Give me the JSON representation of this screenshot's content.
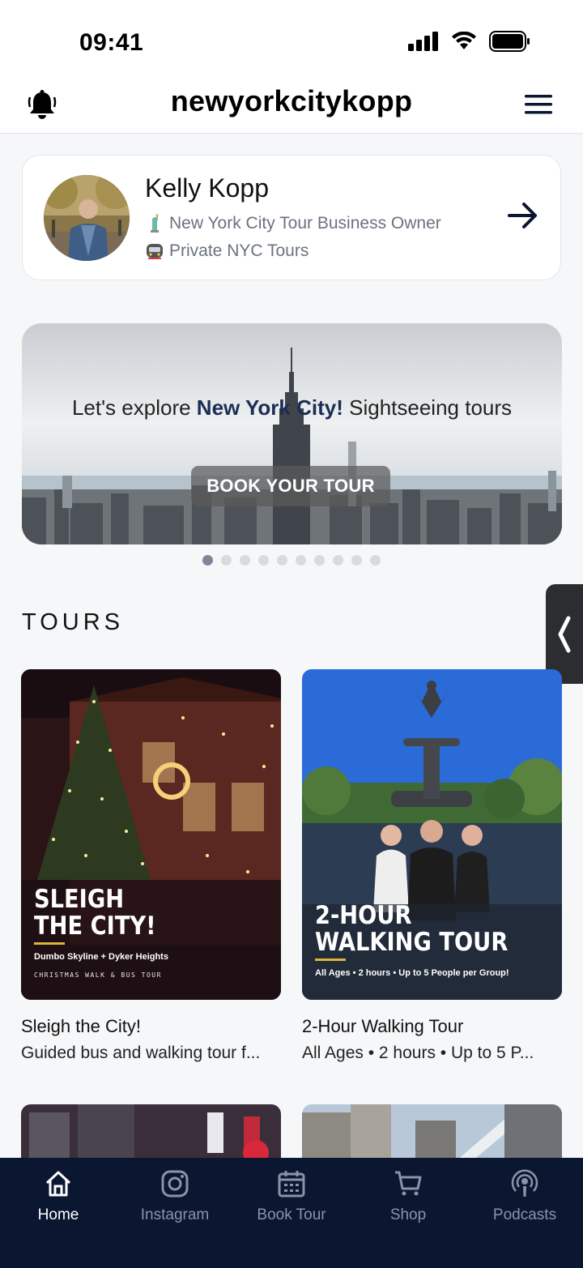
{
  "status": {
    "time": "09:41"
  },
  "header": {
    "title": "newyorkcitykopp"
  },
  "profile": {
    "name": "Kelly Kopp",
    "line1": "New York City Tour Business Owner",
    "line2": "Private NYC Tours"
  },
  "banner": {
    "text_before": "Let's explore ",
    "text_bold1": "New York",
    "text_bold2": "City!",
    "text_after": " Sightseeing tours",
    "button_label": "BOOK YOUR TOUR",
    "slide_count": 10,
    "active_slide": 1
  },
  "tours_section": {
    "title": "TOURS"
  },
  "tours": [
    {
      "title": "Sleigh the City!",
      "description": "Guided bus and walking tour f...",
      "image_headline_1": "SLEIGH",
      "image_headline_2": "THE CITY!",
      "image_sub": "Dumbo Skyline + Dyker Heights",
      "image_sub2": "CHRISTMAS WALK & BUS TOUR"
    },
    {
      "title": "2-Hour Walking Tour",
      "description": "All Ages • 2 hours • Up to 5 P...",
      "image_headline_1": "2-HOUR",
      "image_headline_2": "WALKING TOUR",
      "image_sub": "All Ages • 2 hours • Up to 5 People per Group!"
    }
  ],
  "nav": [
    {
      "label": "Home",
      "icon": "home-icon",
      "active": true
    },
    {
      "label": "Instagram",
      "icon": "instagram-icon",
      "active": false
    },
    {
      "label": "Book Tour",
      "icon": "calendar-icon",
      "active": false
    },
    {
      "label": "Shop",
      "icon": "cart-icon",
      "active": false
    },
    {
      "label": "Podcasts",
      "icon": "podcast-icon",
      "active": false
    }
  ],
  "colors": {
    "nav_bg": "#0b1631",
    "brand_navy": "#1a2e55",
    "accent_gold": "#e0b33a"
  }
}
